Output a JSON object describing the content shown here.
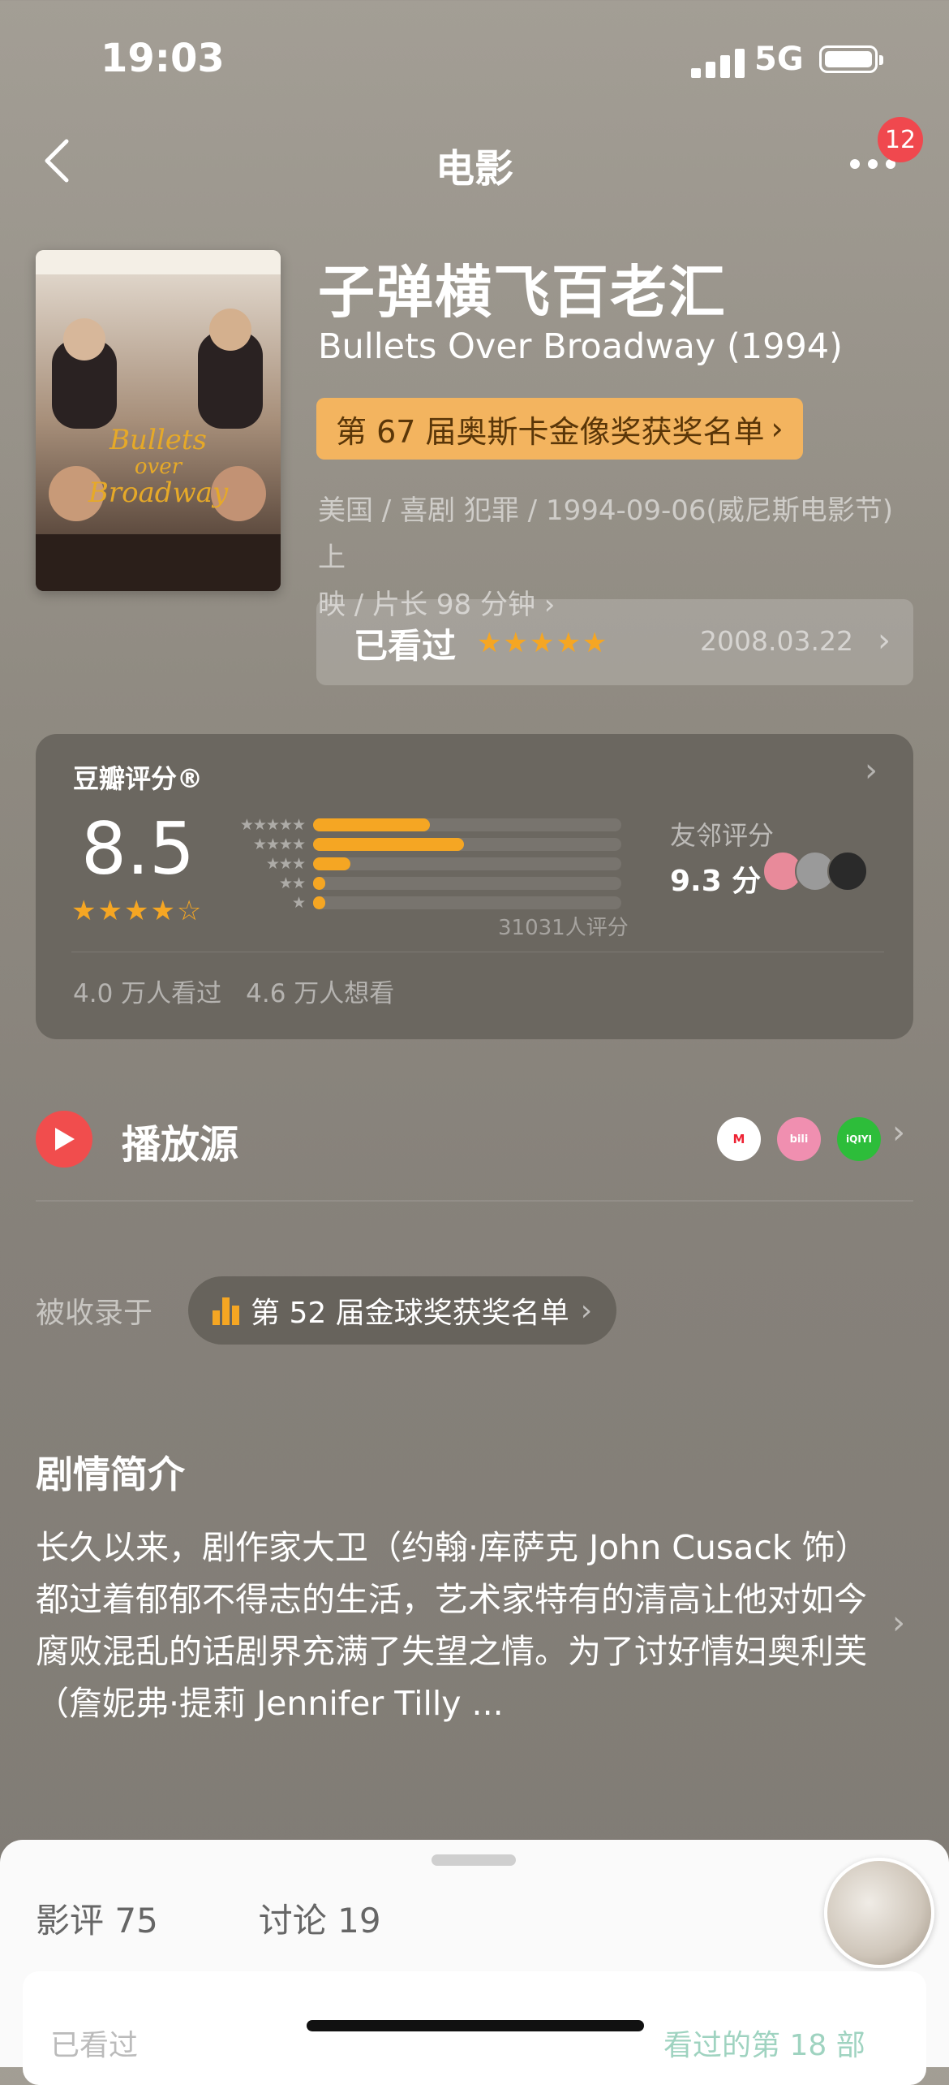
{
  "status_bar": {
    "time": "19:03",
    "network": "5G"
  },
  "nav": {
    "title": "电影",
    "badge": "12"
  },
  "movie": {
    "title_cn": "子弹横飞百老汇",
    "title_en": "Bullets Over Broadway (1994)",
    "award_pill": "第 67 届奥斯卡金像奖获奖名单",
    "meta_line1": "美国 / 喜剧 犯罪 / 1994-09-06(威尼斯电影节) 上",
    "meta_line2": "映 / 片长 98 分钟"
  },
  "watched": {
    "label": "已看过",
    "stars": "★★★★★",
    "date": "2008.03.22"
  },
  "rating": {
    "section_title": "豆瓣评分®",
    "score": "8.5",
    "stars": "★★★★☆",
    "histogram": [
      {
        "stars": "★★★★★",
        "fraction": 0.38
      },
      {
        "stars": "★★★★",
        "fraction": 0.49
      },
      {
        "stars": "★★★",
        "fraction": 0.12
      },
      {
        "stars": "★★",
        "fraction": 0.04
      },
      {
        "stars": "★",
        "fraction": 0.04
      }
    ],
    "votes": "31031人评分",
    "friend_label": "友邻评分",
    "friend_score": "9.3 分",
    "watched_count": "4.0 万人看过",
    "want_count": "4.6 万人想看"
  },
  "play": {
    "label": "播放源",
    "sources": [
      "Migu",
      "bilibili",
      "iQIYI 爱奇艺"
    ]
  },
  "collection": {
    "label": "被收录于",
    "pill": "第 52 届金球奖获奖名单"
  },
  "synopsis": {
    "title": "剧情简介",
    "text": "长久以来，剧作家大卫（约翰·库萨克 John Cusack 饰）都过着郁郁不得志的生活，艺术家特有的清高让他对如今腐败混乱的话剧界充满了失望之情。为了讨好情妇奥利芙（詹妮弗·提莉 Jennifer Tilly ..."
  },
  "sheet": {
    "tab_reviews": "影评 75",
    "tab_discussion": "讨论 19",
    "under_left": "已看过",
    "under_right": "看过的第 18 部"
  },
  "colors": {
    "accent": "#f5a623",
    "play_red": "#f14d4d",
    "badge_red": "#f0484e"
  }
}
